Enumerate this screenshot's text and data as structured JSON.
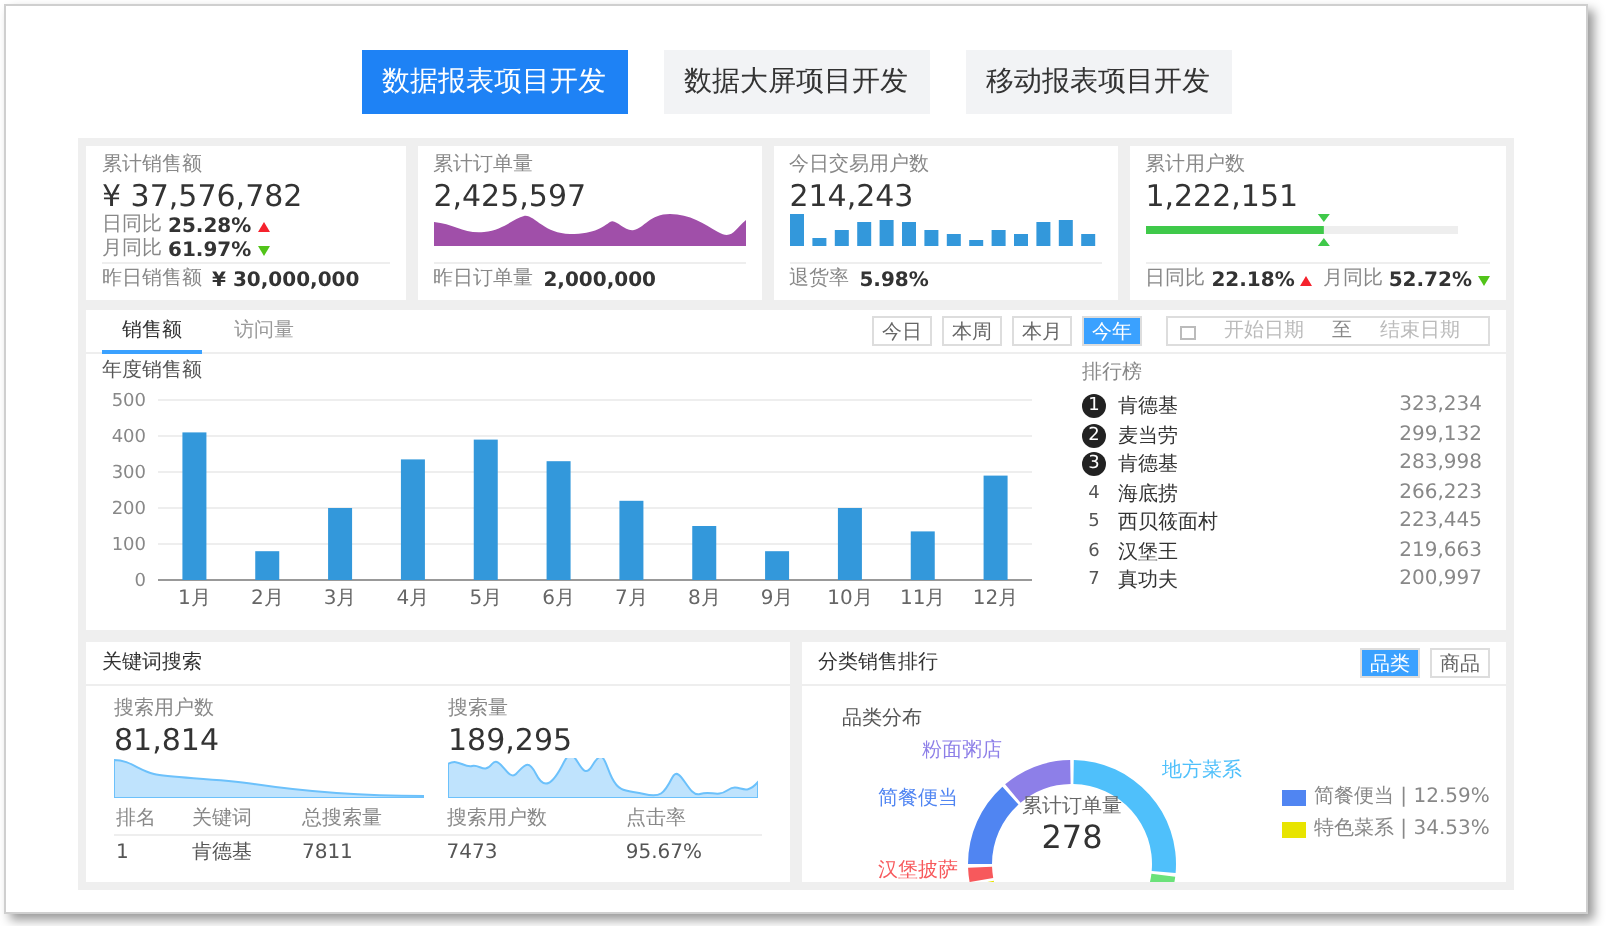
{
  "top_tabs": [
    {
      "label": "数据报表项目开发",
      "selected": true
    },
    {
      "label": "数据大屏项目开发",
      "selected": false
    },
    {
      "label": "移动报表项目开发",
      "selected": false
    }
  ],
  "cards": [
    {
      "kind": "trend",
      "title": "累计销售额",
      "value": "¥ 37,576,782",
      "stats": [
        {
          "label": "日同比",
          "value": "25.28%",
          "rising": true
        },
        {
          "label": "月同比",
          "value": "61.97%",
          "rising": false
        }
      ],
      "footer_label": "昨日销售额",
      "footer_value": "¥ 30,000,000"
    },
    {
      "kind": "area",
      "title": "累计订单量",
      "value": "2,425,597",
      "footer_label": "昨日订单量",
      "footer_value": "2,000,000"
    },
    {
      "kind": "bars",
      "title": "今日交易用户数",
      "value": "214,243",
      "footer_label": "退货率",
      "footer_value": "5.98%"
    },
    {
      "kind": "progress",
      "title": "累计用户数",
      "value": "1,222,151",
      "level": 0.57,
      "stats": [
        {
          "label": "日同比",
          "value": "22.18%",
          "rising": true
        },
        {
          "label": "月同比",
          "value": "52.72%",
          "rising": false
        }
      ]
    }
  ],
  "sales": {
    "tabs": [
      {
        "label": "销售额",
        "selected": true
      },
      {
        "label": "访问量",
        "selected": false
      }
    ],
    "ranges": [
      {
        "label": "今日",
        "selected": false
      },
      {
        "label": "本周",
        "selected": false
      },
      {
        "label": "本月",
        "selected": false
      },
      {
        "label": "今年",
        "selected": true
      }
    ],
    "date_range": {
      "start_placeholder": "开始日期",
      "separator": "至",
      "end_placeholder": "结束日期"
    },
    "chart_data": {
      "type": "bar",
      "title": "年度销售额",
      "categories": [
        "1月",
        "2月",
        "3月",
        "4月",
        "5月",
        "6月",
        "7月",
        "8月",
        "9月",
        "10月",
        "11月",
        "12月"
      ],
      "values": [
        410,
        80,
        200,
        335,
        390,
        330,
        220,
        150,
        80,
        200,
        135,
        290
      ],
      "ylim": [
        0,
        500
      ],
      "yticks": [
        0,
        100,
        200,
        300,
        400,
        500
      ],
      "grid": true
    },
    "ranking": {
      "title": "排行榜",
      "rows": [
        {
          "rank": "1",
          "name": "肯德基",
          "value": "323,234",
          "highlighted": true
        },
        {
          "rank": "2",
          "name": "麦当劳",
          "value": "299,132",
          "highlighted": true
        },
        {
          "rank": "3",
          "name": "肯德基",
          "value": "283,998",
          "highlighted": true
        },
        {
          "rank": "4",
          "name": "海底捞",
          "value": "266,223",
          "highlighted": false
        },
        {
          "rank": "5",
          "name": "西贝筱面村",
          "value": "223,445",
          "highlighted": false
        },
        {
          "rank": "6",
          "name": "汉堡王",
          "value": "219,663",
          "highlighted": false
        },
        {
          "rank": "7",
          "name": "真功夫",
          "value": "200,997",
          "highlighted": false
        }
      ]
    }
  },
  "keywords": {
    "title": "关键词搜索",
    "metrics": [
      {
        "label": "搜索用户数",
        "value": "81,814",
        "kind": "decline"
      },
      {
        "label": "搜索量",
        "value": "189,295",
        "kind": "wave"
      }
    ],
    "columns": [
      "排名",
      "关键词",
      "总搜索量",
      "搜索用户数",
      "点击率"
    ],
    "rows": [
      [
        "1",
        "肯德基",
        "7811",
        "7473",
        "95.67%"
      ]
    ]
  },
  "category": {
    "title": "分类销售排行",
    "toggles": [
      {
        "label": "品类",
        "selected": true
      },
      {
        "label": "商品",
        "selected": false
      }
    ],
    "subtitle": "品类分布",
    "center_label": "累计订单量",
    "center_value": "278",
    "donut_labels": [
      {
        "label": "粉面粥店",
        "color": "#8d7fe8"
      },
      {
        "label": "简餐便当",
        "color": "#5085f2"
      },
      {
        "label": "汉堡披萨",
        "color": "#f7595c"
      },
      {
        "label": "地方菜系",
        "color": "#4fc0fb"
      }
    ],
    "legend": [
      {
        "label": "简餐便当 | 12.59%",
        "color": "#5085f2"
      },
      {
        "label": "特色菜系 | 34.53%",
        "color": "#e8e400"
      }
    ]
  }
}
